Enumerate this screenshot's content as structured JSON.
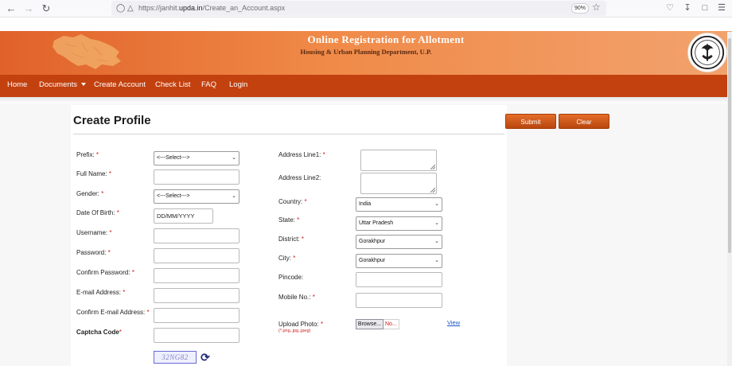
{
  "browser": {
    "url_prefix": "https://janhit.",
    "url_domain": "upda.in",
    "url_path": "/Create_an_Account.aspx",
    "zoom": "90%"
  },
  "header": {
    "title": "Online Registration for Allotment",
    "subtitle": "Housing & Urban Planning Department, U.P."
  },
  "nav": {
    "home": "Home",
    "documents": "Documents",
    "create_account": "Create Account",
    "check_list": "Check List",
    "faq": "FAQ",
    "login": "Login"
  },
  "page": {
    "title": "Create Profile",
    "submit": "Submit",
    "clear": "Clear"
  },
  "form": {
    "prefix_label": "Prefix:",
    "prefix_value": "<---Select--->",
    "fullname_label": "Full Name:",
    "gender_label": "Gender:",
    "gender_value": "<---Select--->",
    "dob_label": "Date Of Birth:",
    "dob_placeholder": "DD/MM/YYYY",
    "username_label": "Username:",
    "password_label": "Password:",
    "confirm_password_label": "Confirm Password:",
    "email_label": "E-mail Address:",
    "confirm_email_label": "Confirm E-mail Address:",
    "captcha_label": "Captcha Code",
    "captcha_text": "32NG82",
    "address1_label": "Address Line1:",
    "address2_label": "Address Line2:",
    "country_label": "Country:",
    "country_value": "India",
    "state_label": "State:",
    "state_value": "Uttar Pradesh",
    "district_label": "District:",
    "district_value": "Gorakhpur",
    "city_label": "City:",
    "city_value": "Gorakhpur",
    "pincode_label": "Pincode:",
    "mobile_label": "Mobile No.:",
    "photo_label": "Upload Photo:",
    "photo_hint": "(*.png,.jpg,.jpeg)",
    "browse_label": "Browse...",
    "no_file": "No...",
    "view_link": "View",
    "required_mark": "*"
  },
  "colors": {
    "header_start": "#e0622a",
    "header_end": "#f2a26e",
    "nav_bg": "#c2410f",
    "button": "#c8541a",
    "required": "#d21a1a",
    "link": "#1a55c8"
  }
}
